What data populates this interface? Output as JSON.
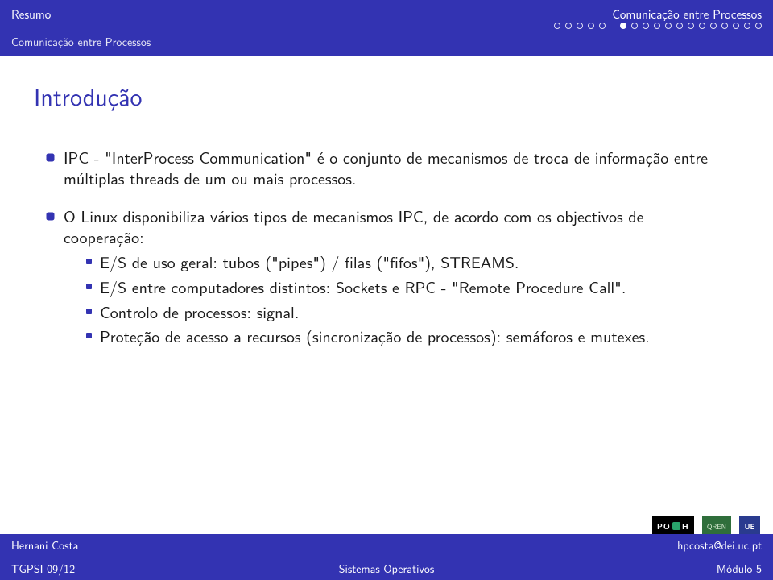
{
  "header": {
    "nav_left": "Resumo",
    "nav_right": "Comunicação entre Processos",
    "sub": "Comunicação entre Processos"
  },
  "progress": {
    "total": 18,
    "filled_index": 5
  },
  "title": "Introdução",
  "bullets": [
    {
      "text": "IPC - \"InterProcess Communication\" é o conjunto de mecanismos de troca de informação entre múltiplas threads de um ou mais processos."
    },
    {
      "text": "O Linux disponibiliza vários tipos de mecanismos IPC, de acordo com os objectivos de cooperação:",
      "sub": [
        "E/S de uso geral: tubos (\"pipes\") / filas (\"fifos\"), STREAMS.",
        "E/S entre computadores distintos: Sockets e RPC - \"Remote Procedure Call\".",
        "Controlo de processos: signal.",
        "Proteção de acesso a recursos (sincronização de processos): semáforos e mutexes."
      ]
    }
  ],
  "logos": {
    "poph_prefix": "PO",
    "poph_suffix": "H",
    "qren": "QREN",
    "ue": "UE"
  },
  "footer": {
    "author": "Hernani Costa",
    "email": "hpcosta@dei.uc.pt",
    "course": "TGPSI 09/12",
    "center": "Sistemas Operativos",
    "module": "Módulo 5"
  }
}
